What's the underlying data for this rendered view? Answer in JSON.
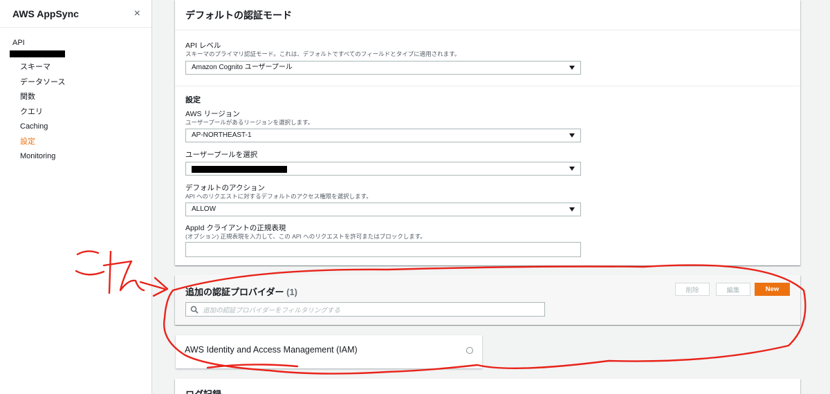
{
  "sidebar": {
    "title": "AWS AppSync",
    "close_icon": "×",
    "api_label": "API",
    "items": [
      {
        "label": "スキーマ",
        "active": false
      },
      {
        "label": "データソース",
        "active": false
      },
      {
        "label": "関数",
        "active": false
      },
      {
        "label": "クエリ",
        "active": false
      },
      {
        "label": "Caching",
        "active": false
      },
      {
        "label": "設定",
        "active": true
      },
      {
        "label": "Monitoring",
        "active": false
      }
    ]
  },
  "auth": {
    "title": "デフォルトの認証モード",
    "api_level": {
      "label": "API レベル",
      "desc": "スキーマのプライマリ認証モード。これは、デフォルトですべてのフィールドとタイプに適用されます。",
      "value": "Amazon Cognito ユーザープール"
    },
    "settings": {
      "title": "設定",
      "region": {
        "label": "AWS リージョン",
        "desc": "ユーザープールがあるリージョンを選択します。",
        "value": "AP-NORTHEAST-1"
      },
      "user_pool": {
        "label": "ユーザープールを選択"
      },
      "default_action": {
        "label": "デフォルトのアクション",
        "desc": "API へのリクエストに対するデフォルトのアクセス権限を選択します。",
        "value": "ALLOW"
      },
      "appid": {
        "label": "AppId クライアントの正規表現",
        "desc": "(オプション) 正規表現を入力して、この API へのリクエストを許可またはブロックします。",
        "value": ""
      }
    }
  },
  "providers": {
    "title": "追加の認証プロバイダー",
    "count": "(1)",
    "delete_label": "削除",
    "edit_label": "編集",
    "new_label": "New",
    "filter_placeholder": "追加の認証プロバイダーをフィルタリングする",
    "items": [
      {
        "label": "AWS Identity and Access Management (IAM)"
      }
    ]
  },
  "logging": {
    "title": "ログ記録"
  },
  "annotation": {
    "color": "#e8231a"
  },
  "colors": {
    "accent": "#ec7211"
  }
}
